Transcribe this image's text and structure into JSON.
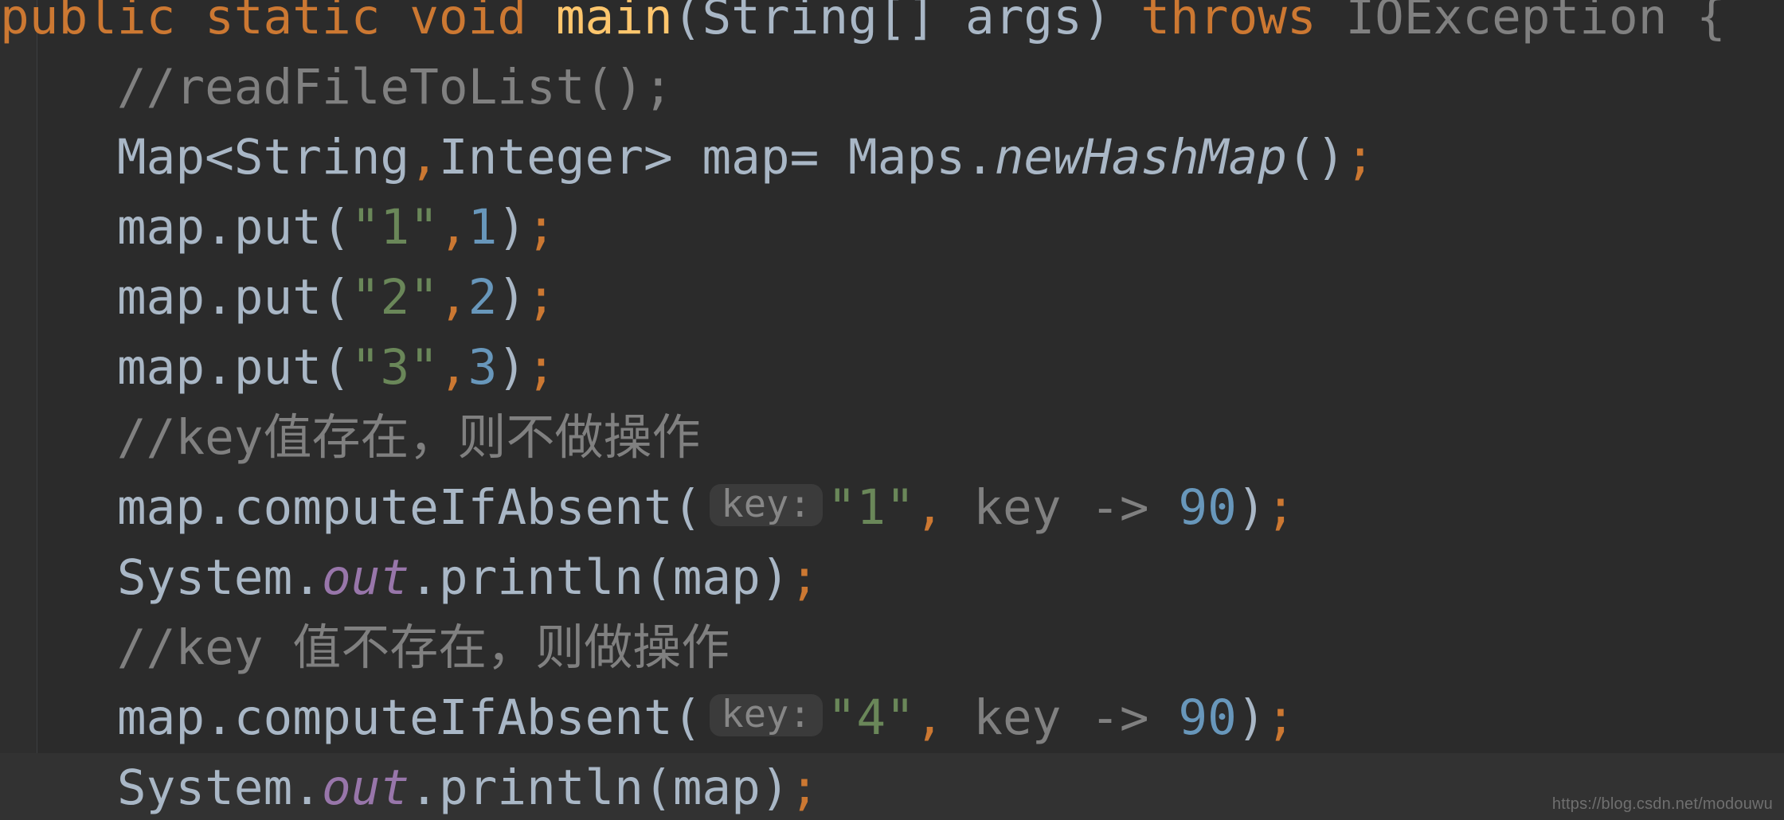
{
  "editor": {
    "theme": "darcula",
    "background": "#2b2b2b",
    "current_line_background": "#323232",
    "gutter_background": "#2e2e2e",
    "indent_guide_color": "#3d3f41",
    "default_foreground": "#a9b7c6",
    "keyword_color": "#cc7832",
    "string_color": "#6a8759",
    "number_color": "#6897bb",
    "comment_color": "#808080",
    "method_name_color": "#ffc66d",
    "static_field_color": "#9876aa",
    "hint_background": "#3b3b3b",
    "hint_foreground": "#868686",
    "language": "Java"
  },
  "lines": [
    {
      "id": "line-method-signature",
      "indent": "",
      "tokens": [
        {
          "t": "public",
          "c": "kw"
        },
        {
          "t": " ",
          "c": "plain"
        },
        {
          "t": "static",
          "c": "kw"
        },
        {
          "t": " ",
          "c": "plain"
        },
        {
          "t": "void",
          "c": "kw"
        },
        {
          "t": " ",
          "c": "plain"
        },
        {
          "t": "main",
          "c": "mname"
        },
        {
          "t": "(String[] args) ",
          "c": "plain"
        },
        {
          "t": "throws",
          "c": "kw"
        },
        {
          "t": " ",
          "c": "plain"
        },
        {
          "t": "IOException",
          "c": "dim"
        },
        {
          "t": " ",
          "c": "plain"
        },
        {
          "t": "{",
          "c": "dim"
        }
      ]
    },
    {
      "id": "line-comment-readfiletolist",
      "indent": "    ",
      "tokens": [
        {
          "t": "//readFileToList();",
          "c": "cmt"
        }
      ]
    },
    {
      "id": "line-map-declaration",
      "indent": "    ",
      "tokens": [
        {
          "t": "Map<String",
          "c": "plain"
        },
        {
          "t": ",",
          "c": "punc"
        },
        {
          "t": "Integer> map= Maps.",
          "c": "plain"
        },
        {
          "t": "newHashMap",
          "c": "statm"
        },
        {
          "t": "()",
          "c": "plain"
        },
        {
          "t": ";",
          "c": "punc"
        }
      ]
    },
    {
      "id": "line-map-put-1",
      "indent": "    ",
      "tokens": [
        {
          "t": "map.put(",
          "c": "plain"
        },
        {
          "t": "\"1\"",
          "c": "str"
        },
        {
          "t": ",",
          "c": "punc"
        },
        {
          "t": "1",
          "c": "num"
        },
        {
          "t": ")",
          "c": "plain"
        },
        {
          "t": ";",
          "c": "punc"
        }
      ]
    },
    {
      "id": "line-map-put-2",
      "indent": "    ",
      "tokens": [
        {
          "t": "map.put(",
          "c": "plain"
        },
        {
          "t": "\"2\"",
          "c": "str"
        },
        {
          "t": ",",
          "c": "punc"
        },
        {
          "t": "2",
          "c": "num"
        },
        {
          "t": ")",
          "c": "plain"
        },
        {
          "t": ";",
          "c": "punc"
        }
      ]
    },
    {
      "id": "line-map-put-3",
      "indent": "    ",
      "tokens": [
        {
          "t": "map.put(",
          "c": "plain"
        },
        {
          "t": "\"3\"",
          "c": "str"
        },
        {
          "t": ",",
          "c": "punc"
        },
        {
          "t": "3",
          "c": "num"
        },
        {
          "t": ")",
          "c": "plain"
        },
        {
          "t": ";",
          "c": "punc"
        }
      ]
    },
    {
      "id": "line-comment-key-exists",
      "indent": "    ",
      "tokens": [
        {
          "t": "//key值存在，则不做操作",
          "c": "cmt"
        }
      ]
    },
    {
      "id": "line-computeifabsent-1",
      "indent": "    ",
      "tokens": [
        {
          "t": "map.computeIfAbsent(",
          "c": "plain"
        },
        {
          "t": "key:",
          "c": "hint"
        },
        {
          "t": "\"1\"",
          "c": "str"
        },
        {
          "t": ",",
          "c": "punc"
        },
        {
          "t": " ",
          "c": "plain"
        },
        {
          "t": "key",
          "c": "lambda"
        },
        {
          "t": " ",
          "c": "plain"
        },
        {
          "t": "->",
          "c": "lambda"
        },
        {
          "t": " ",
          "c": "plain"
        },
        {
          "t": "90",
          "c": "num"
        },
        {
          "t": ")",
          "c": "plain"
        },
        {
          "t": ";",
          "c": "punc"
        }
      ]
    },
    {
      "id": "line-println-1",
      "indent": "    ",
      "tokens": [
        {
          "t": "System.",
          "c": "plain"
        },
        {
          "t": "out",
          "c": "stat"
        },
        {
          "t": ".println(map)",
          "c": "plain"
        },
        {
          "t": ";",
          "c": "punc"
        }
      ]
    },
    {
      "id": "line-comment-key-not-exists",
      "indent": "    ",
      "tokens": [
        {
          "t": "//key 值不存在，则做操作",
          "c": "cmt"
        }
      ]
    },
    {
      "id": "line-computeifabsent-2",
      "indent": "    ",
      "tokens": [
        {
          "t": "map.computeIfAbsent(",
          "c": "plain"
        },
        {
          "t": "key:",
          "c": "hint"
        },
        {
          "t": "\"4\"",
          "c": "str"
        },
        {
          "t": ",",
          "c": "punc"
        },
        {
          "t": " ",
          "c": "plain"
        },
        {
          "t": "key",
          "c": "lambda"
        },
        {
          "t": " ",
          "c": "plain"
        },
        {
          "t": "->",
          "c": "lambda"
        },
        {
          "t": " ",
          "c": "plain"
        },
        {
          "t": "90",
          "c": "num"
        },
        {
          "t": ")",
          "c": "plain"
        },
        {
          "t": ";",
          "c": "punc"
        }
      ]
    },
    {
      "id": "line-println-2",
      "indent": "    ",
      "current": true,
      "tokens": [
        {
          "t": "System.",
          "c": "plain"
        },
        {
          "t": "out",
          "c": "stat"
        },
        {
          "t": ".println(map)",
          "c": "plain"
        },
        {
          "t": ";",
          "c": "punc"
        }
      ]
    }
  ],
  "watermark": {
    "text": "https://blog.csdn.net/modouwu"
  }
}
